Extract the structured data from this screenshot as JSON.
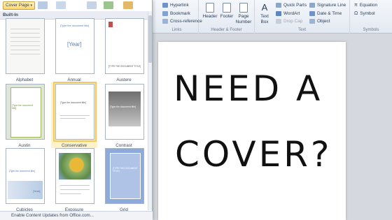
{
  "ribbon": {
    "links": {
      "group_label": "Links",
      "items": [
        "Hyperlink",
        "Bookmark",
        "Cross-reference"
      ]
    },
    "header_footer": {
      "group_label": "Header & Footer",
      "buttons": [
        "Header",
        "Footer",
        "Page",
        "Number"
      ]
    },
    "text": {
      "group_label": "Text",
      "textbox_line1": "Text",
      "textbox_line2": "Box",
      "items": [
        "Quick Parts",
        "WordArt",
        "Drop Cap",
        "Signature Line",
        "Date & Time",
        "Object"
      ]
    },
    "symbols": {
      "group_label": "Symbols",
      "items": [
        "Equation",
        "Symbol"
      ]
    }
  },
  "dropdown": {
    "button_label": "Cover Page",
    "section_header": "Built-In",
    "footer_link": "Enable Content Updates from Office.com...",
    "tiles": [
      {
        "name": "Alphabet",
        "thumb_text": ""
      },
      {
        "name": "Annual",
        "thumb_text": "[Type the document title]",
        "thumb_year": "[Year]"
      },
      {
        "name": "Austere",
        "thumb_text": "[TYPE THE DOCUMENT TITLE]"
      },
      {
        "name": "Austin",
        "thumb_text": "[Type the document title]"
      },
      {
        "name": "Conservative",
        "thumb_text": "[Type the document title]"
      },
      {
        "name": "Contrast",
        "thumb_text": "[Type the document title]"
      },
      {
        "name": "Cubicles",
        "thumb_text": "[Type the document title]",
        "thumb_year": "[Year]"
      },
      {
        "name": "Exposure",
        "thumb_text": ""
      },
      {
        "name": "Grid",
        "thumb_text": "[TYPE THE DOCUMENT TITLE]"
      }
    ]
  },
  "document": {
    "line1": "NEED A",
    "line2": "COVER?"
  },
  "colors": {
    "accent_blue": "#4f81bd",
    "selected_tile": "#fff2c8",
    "button_gold": "#ffd86b"
  }
}
